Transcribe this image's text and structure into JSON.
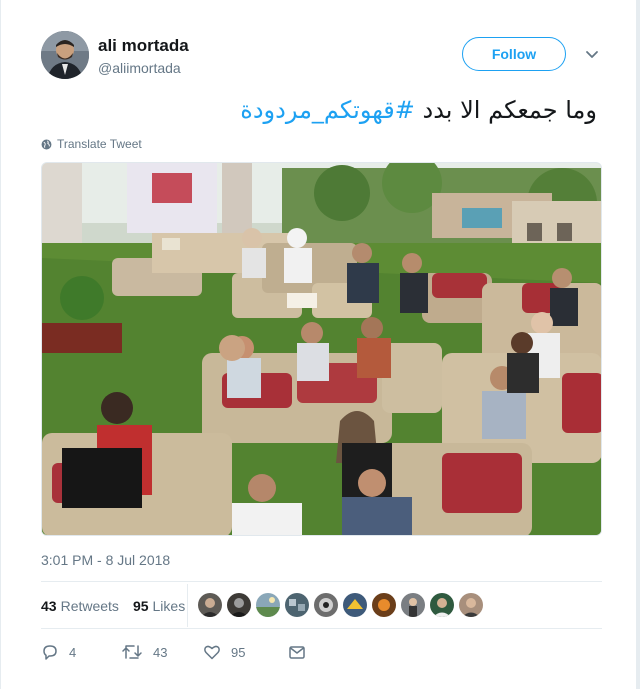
{
  "user": {
    "display_name": "ali mortada",
    "handle": "@aliimortada",
    "follow_label": "Follow"
  },
  "tweet": {
    "text_prefix": "وما جمعكم الا بدد ",
    "hashtag": "#قهوتكم_مردودة",
    "translate_label": "Translate Tweet",
    "timestamp": "3:01 PM - 8 Jul 2018"
  },
  "stats": {
    "retweets_count": "43",
    "retweets_label": "Retweets",
    "likes_count": "95",
    "likes_label": "Likes"
  },
  "actions": {
    "reply_count": "4",
    "retweet_count": "43",
    "like_count": "95"
  },
  "likers": [
    {
      "color": "#5d5a55"
    },
    {
      "color": "#3d3a36"
    },
    {
      "color": "#8aa7b8"
    },
    {
      "color": "#4d6470"
    },
    {
      "color": "#6d6d6d"
    },
    {
      "color": "#3e5a7a"
    },
    {
      "color": "#6b3e1a"
    },
    {
      "color": "#7a7e82"
    },
    {
      "color": "#2f5a3f"
    },
    {
      "color": "#a88f7c"
    }
  ],
  "colors": {
    "accent": "#1da1f2",
    "secondary_text": "#657786"
  }
}
